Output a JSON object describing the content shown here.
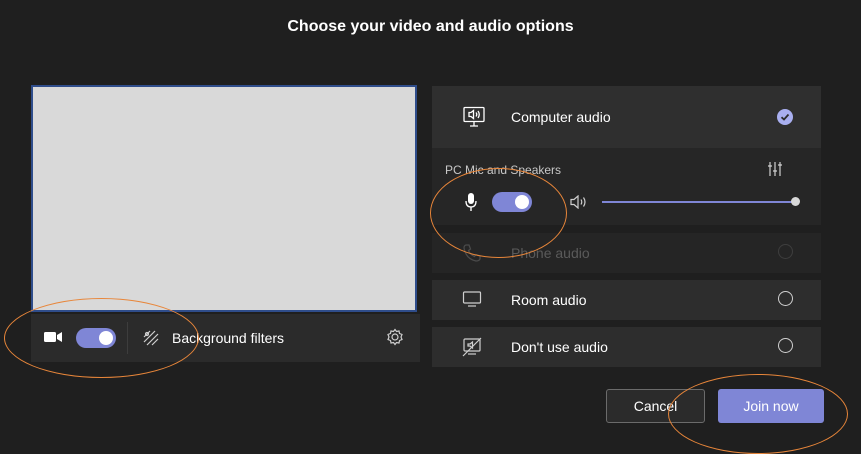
{
  "title": "Choose your video and audio options",
  "video": {
    "background_filters_label": "Background filters",
    "camera_on": true
  },
  "audio": {
    "computer_audio": {
      "label": "Computer audio",
      "selected": true
    },
    "device_label": "PC Mic and Speakers",
    "mic_on": true,
    "volume_level": 1.0,
    "phone_audio": {
      "label": "Phone audio",
      "disabled": true
    },
    "room_audio": {
      "label": "Room audio"
    },
    "no_audio": {
      "label": "Don't use audio"
    }
  },
  "buttons": {
    "cancel": "Cancel",
    "join": "Join now"
  },
  "colors": {
    "accent": "#7f86d6",
    "annotation": "#e8863a",
    "background": "#1f1f1f"
  },
  "icons": {
    "camera": "camera-icon",
    "background_filters": "background-filters-icon",
    "settings": "gear-icon",
    "computer_audio": "computer-audio-icon",
    "equalizer": "equalizer-icon",
    "microphone": "microphone-icon",
    "speaker": "speaker-icon",
    "phone": "phone-icon",
    "room": "room-audio-icon",
    "no_audio": "no-audio-icon",
    "checkmark": "checkmark-icon"
  }
}
